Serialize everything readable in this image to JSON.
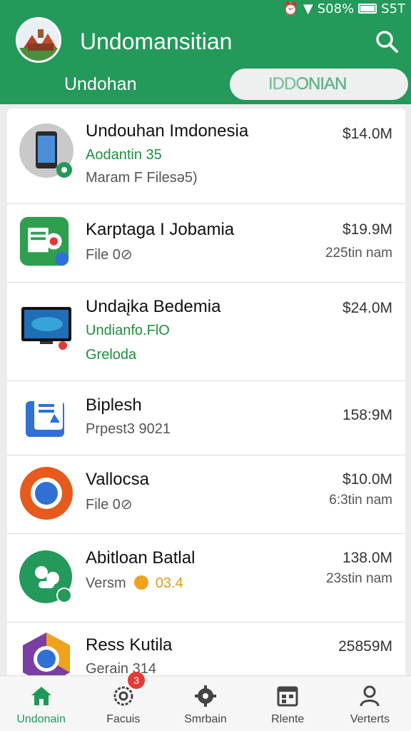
{
  "status_bar": {
    "battery_text": "S08%",
    "extra": "S5T"
  },
  "header": {
    "title": "Undomansitian",
    "tab_left": "Undohan",
    "tab_right": "IDDONIAN"
  },
  "items": [
    {
      "name": "Undouhan Imdonesia",
      "sub1": "Aodantin 35",
      "sub2": "Maram F Filesǝ5)",
      "price": "$14.0M"
    },
    {
      "name": "Karptaga I Jobamia",
      "sub1": "File 0⊘",
      "price": "$19.9M",
      "meta": "225tin nam"
    },
    {
      "name": "Undaįka Bedemia",
      "sub1": "Undianfo.FlO",
      "sub2": "Greloda",
      "price": "$24.0M"
    },
    {
      "name": "Biplesh",
      "sub1": "Prpest3 9021",
      "price": "158:9M"
    },
    {
      "name": "Vallocsa",
      "sub1": "File 0⊘",
      "price": "$10.0M",
      "meta": "6:3tin nam"
    },
    {
      "name": "Abitloan Batlal",
      "sub1": "Versm",
      "sub1_accent": "03.4",
      "price": "138.0M",
      "meta": "23stin nam"
    },
    {
      "name": "Ress Kutila",
      "sub1": "Gerain",
      "sub1_accent": "314",
      "price": "25859M"
    }
  ],
  "bottom_nav": [
    {
      "label": "Undonain",
      "icon": "home-icon"
    },
    {
      "label": "Facuis",
      "icon": "settings-gear-icon",
      "badge": "3"
    },
    {
      "label": "Smrbain",
      "icon": "gear-icon"
    },
    {
      "label": "Rlente",
      "icon": "calendar-icon"
    },
    {
      "label": "Verterts",
      "icon": "person-icon"
    }
  ],
  "colors": {
    "primary": "#23995a",
    "badge": "#e53935"
  }
}
